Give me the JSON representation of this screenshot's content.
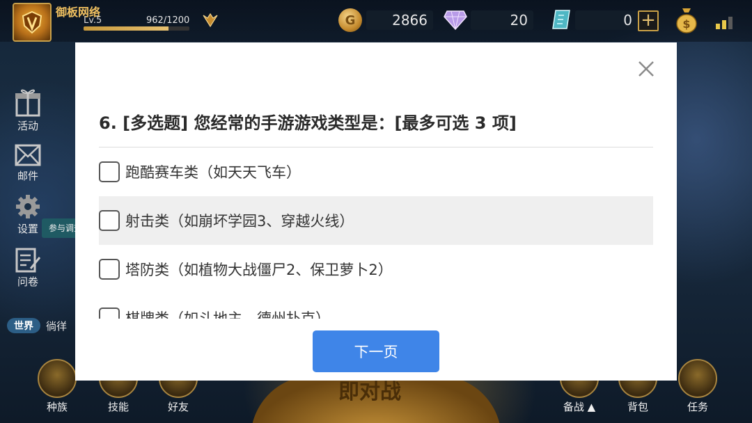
{
  "player": {
    "name": "御板网络",
    "level": "Lv.5",
    "xp_text": "962/1200",
    "xp_fraction": 0.8
  },
  "currencies": {
    "gold": "2866",
    "diamonds": "20",
    "tickets": "0",
    "gold_icon": "G"
  },
  "sidebar": {
    "items": [
      {
        "label": "活动",
        "icon": "gift-icon"
      },
      {
        "label": "邮件",
        "icon": "mail-icon"
      },
      {
        "label": "设置",
        "icon": "gear-icon"
      },
      {
        "label": "问卷",
        "icon": "survey-icon"
      }
    ],
    "survey_tip": "参与调查"
  },
  "chat": {
    "channel": "世界",
    "preview": "徜徉"
  },
  "bottom_menu": {
    "left": [
      {
        "label": "种族"
      },
      {
        "label": "技能"
      },
      {
        "label": "好友"
      }
    ],
    "right": [
      {
        "label": "备战 ▲"
      },
      {
        "label": "背包"
      },
      {
        "label": "任务"
      }
    ],
    "center_banner": "即对战"
  },
  "survey": {
    "question": "6. [多选题] 您经常的手游游戏类型是：[最多可选 3 项]",
    "options": [
      {
        "label": "跑酷赛车类（如天天飞车）",
        "checked": false,
        "highlighted": false
      },
      {
        "label": "射击类（如崩坏学园3、穿越火线）",
        "checked": false,
        "highlighted": true
      },
      {
        "label": "塔防类（如植物大战僵尸2、保卫萝卜2）",
        "checked": false,
        "highlighted": false
      },
      {
        "label": "棋牌类（如斗地主、德州扑克）",
        "checked": false,
        "highlighted": false
      }
    ],
    "next_label": "下一页"
  },
  "colors": {
    "accent_blue": "#3f85e8",
    "highlight_row": "#efefef",
    "gold": "#c9a046"
  }
}
